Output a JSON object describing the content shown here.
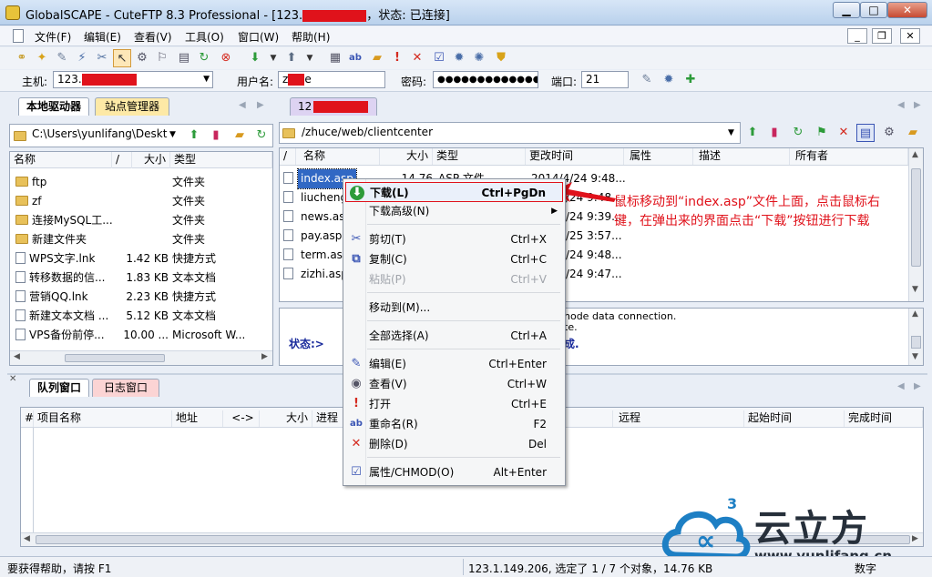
{
  "window": {
    "title_prefix": "GlobalSCAPE - CuteFTP 8.3 Professional - [123.",
    "title_suffix": "，状态: 已连接]",
    "min_label": "▁",
    "max_label": "□",
    "close_label": "✕"
  },
  "menu": [
    "文件(F)",
    "编辑(E)",
    "查看(V)",
    "工具(O)",
    "窗口(W)",
    "帮助(H)"
  ],
  "mdi_buttons": [
    "_",
    "❐",
    "✕"
  ],
  "quickconnect": {
    "host_label": "主机:",
    "host_value": "123.",
    "user_label": "用户名:",
    "user_value": "z",
    "user_suffix": "e",
    "pass_label": "密码:",
    "pass_value": "●●●●●●●●●●●●●●",
    "port_label": "端口:",
    "port_value": "21"
  },
  "left": {
    "tabs": [
      "本地驱动器",
      "站点管理器"
    ],
    "path": "C:\\Users\\yunlifang\\Deskt",
    "columns": [
      "名称",
      "/",
      "大小",
      "类型"
    ],
    "rows": [
      {
        "name": "ftp",
        "size": "",
        "type": "文件夹",
        "icon": "folder"
      },
      {
        "name": "zf",
        "size": "",
        "type": "文件夹",
        "icon": "folder"
      },
      {
        "name": "连接MySQL工...",
        "size": "",
        "type": "文件夹",
        "icon": "folder"
      },
      {
        "name": "新建文件夹",
        "size": "",
        "type": "文件夹",
        "icon": "folder"
      },
      {
        "name": "WPS文字.lnk",
        "size": "1.42 KB",
        "type": "快捷方式",
        "icon": "doc"
      },
      {
        "name": "转移数据的信...",
        "size": "1.83 KB",
        "type": "文本文档",
        "icon": "doc"
      },
      {
        "name": "营销QQ.lnk",
        "size": "2.23 KB",
        "type": "快捷方式",
        "icon": "doc"
      },
      {
        "name": "新建文本文档 ...",
        "size": "5.12 KB",
        "type": "文本文档",
        "icon": "doc"
      },
      {
        "name": "VPS备份前停...",
        "size": "10.00 ...",
        "type": "Microsoft W...",
        "icon": "doc"
      }
    ]
  },
  "right": {
    "tab": "12",
    "path": "/zhuce/web/clientcenter",
    "columns": [
      "/",
      "名称",
      "大小",
      "类型",
      "更改时间",
      "属性",
      "描述",
      "所有者"
    ],
    "rows": [
      {
        "name": "index.asp",
        "size": "14.76",
        "type": "ASP 文件",
        "time": "2014/4/24 9:48..."
      },
      {
        "name": "liucheng",
        "time": "/24 9:48..."
      },
      {
        "name": "news.asp",
        "time": "/24 9:39..."
      },
      {
        "name": "pay.asp",
        "time": "/25 3:57..."
      },
      {
        "name": "term.asp",
        "time": "/24 9:48..."
      },
      {
        "name": "zizhi.asp",
        "time": "/24 9:47..."
      }
    ],
    "log_line1": "node data connection.",
    "log_line2": "te.",
    "status_label": "状态:>",
    "status_tail": "成."
  },
  "annotation": {
    "line1": "鼠标移动到“index.asp”文件上面，点击鼠标右",
    "line2": "键，在弹出来的界面点击“下载”按钮进行下载"
  },
  "context_menu": [
    {
      "label": "下载(L)",
      "shortcut": "Ctrl+PgDn",
      "icon": "download-icon",
      "glyph": "⬇"
    },
    {
      "label": "下载高级(N)",
      "shortcut": "",
      "icon": "submenu-arrow-icon",
      "glyph": ""
    },
    {
      "label": "剪切(T)",
      "shortcut": "Ctrl+X",
      "icon": "cut-icon",
      "glyph": "✂"
    },
    {
      "label": "复制(C)",
      "shortcut": "Ctrl+C",
      "icon": "copy-icon",
      "glyph": "⧉"
    },
    {
      "label": "粘贴(P)",
      "shortcut": "Ctrl+V",
      "icon": "paste-icon",
      "glyph": ""
    },
    {
      "label": "移动到(M)...",
      "shortcut": "",
      "icon": "",
      "glyph": ""
    },
    {
      "label": "全部选择(A)",
      "shortcut": "Ctrl+A",
      "icon": "",
      "glyph": ""
    },
    {
      "label": "编辑(E)",
      "shortcut": "Ctrl+Enter",
      "icon": "edit-icon",
      "glyph": "✎"
    },
    {
      "label": "查看(V)",
      "shortcut": "Ctrl+W",
      "icon": "view-icon",
      "glyph": "◉"
    },
    {
      "label": "打开",
      "shortcut": "Ctrl+E",
      "icon": "open-icon",
      "glyph": "!"
    },
    {
      "label": "重命名(R)",
      "shortcut": "F2",
      "icon": "rename-icon",
      "glyph": "ab"
    },
    {
      "label": "删除(D)",
      "shortcut": "Del",
      "icon": "delete-icon",
      "glyph": "✕"
    },
    {
      "label": "属性/CHMOD(O)",
      "shortcut": "Alt+Enter",
      "icon": "properties-icon",
      "glyph": "☑"
    }
  ],
  "queue": {
    "tabs": [
      "队列窗口",
      "日志窗口"
    ],
    "columns": [
      "#",
      "项目名称",
      "地址",
      "<->",
      "大小",
      "进程",
      "远程",
      "起始时间",
      "完成时间"
    ]
  },
  "watermark": {
    "brand": "云立方",
    "url": "www.yunlifang.cn",
    "superscript": "3"
  },
  "statusbar": {
    "help": "要获得帮助，请按 F1",
    "info": "123.1.149.206, 选定了 1 / 7 个对象，14.76 KB",
    "num": "数字"
  },
  "colors": {
    "highlight": "#3168c4",
    "annotation_red": "#e0121b",
    "brand_blue": "#1d7fc4",
    "brand_dark": "#262f3a"
  }
}
